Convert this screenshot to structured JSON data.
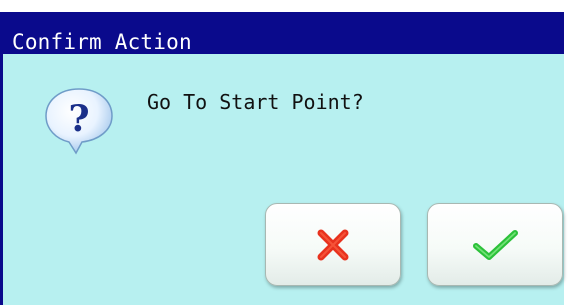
{
  "dialog": {
    "title": "Confirm Action",
    "message": "Go To Start Point?",
    "icon": "question-icon",
    "buttons": {
      "cancel": {
        "icon": "cross-icon",
        "color": "#e8321e"
      },
      "confirm": {
        "icon": "checkmark-icon",
        "color": "#2cc13a"
      }
    }
  },
  "colors": {
    "titlebar": "#0a0a8c",
    "background": "#b7f0f0"
  }
}
